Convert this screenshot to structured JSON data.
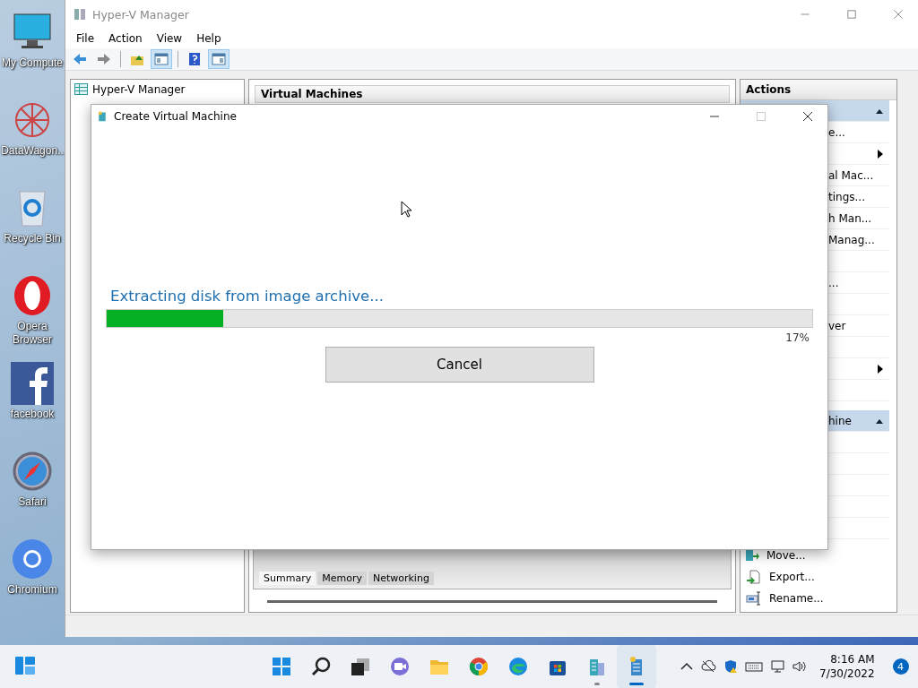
{
  "desktop_icons": [
    {
      "label": "My Compute"
    },
    {
      "label": "DataWagon.."
    },
    {
      "label": "Recycle Bin"
    },
    {
      "label": "Opera Browser"
    },
    {
      "label": "facebook"
    },
    {
      "label": "Safari"
    },
    {
      "label": "Chromium"
    }
  ],
  "window": {
    "title": "Hyper-V Manager",
    "menu": [
      "File",
      "Action",
      "View",
      "Help"
    ],
    "toolbar": [
      {
        "kind": "back",
        "pressed": false
      },
      {
        "kind": "forward",
        "pressed": false
      },
      {
        "kind": "up",
        "pressed": false
      },
      {
        "kind": "tree",
        "pressed": true
      },
      {
        "kind": "help",
        "pressed": false
      },
      {
        "kind": "actions",
        "pressed": true
      }
    ],
    "tree": [
      {
        "label": "Hyper-V Manager"
      }
    ],
    "center": {
      "title": "Virtual Machines",
      "tabs": [
        {
          "label": "Summary",
          "selected": true
        },
        {
          "label": "Memory",
          "selected": false
        },
        {
          "label": "Networking",
          "selected": false
        }
      ]
    },
    "actions": {
      "title": "Actions",
      "rows": [
        {
          "kind": "header"
        },
        {
          "kind": "partial",
          "text": "e..."
        },
        {
          "kind": "submenu"
        },
        {
          "kind": "partial",
          "text": "al Mac..."
        },
        {
          "kind": "partial",
          "text": "tings..."
        },
        {
          "kind": "partial",
          "text": "h Man..."
        },
        {
          "kind": "partial",
          "text": "Manag..."
        },
        {
          "kind": "covered"
        },
        {
          "kind": "partial",
          "text": "..."
        },
        {
          "kind": "covered"
        },
        {
          "kind": "partial",
          "text": "ver"
        },
        {
          "kind": "covered"
        },
        {
          "kind": "submenu"
        },
        {
          "kind": "covered"
        },
        {
          "kind": "header",
          "text": "hine"
        },
        {
          "kind": "covered"
        },
        {
          "kind": "covered"
        },
        {
          "kind": "covered"
        },
        {
          "kind": "covered"
        },
        {
          "kind": "covered"
        },
        {
          "kind": "item",
          "text": "Move..."
        },
        {
          "kind": "item",
          "text": "Export..."
        },
        {
          "kind": "item",
          "text": "Rename..."
        }
      ]
    }
  },
  "dialog": {
    "title": "Create Virtual Machine",
    "status": "Extracting disk from image archive...",
    "progress": {
      "level": 0.165,
      "reading": "17%"
    },
    "button": "Cancel"
  },
  "taskbar": {
    "apps": [
      {
        "kind": "start",
        "running": false,
        "active": false
      },
      {
        "kind": "search",
        "running": false,
        "active": false
      },
      {
        "kind": "taskview",
        "running": false,
        "active": false
      },
      {
        "kind": "chat",
        "running": false,
        "active": false
      },
      {
        "kind": "explorer",
        "running": false,
        "active": false
      },
      {
        "kind": "chrome",
        "running": false,
        "active": false
      },
      {
        "kind": "edge",
        "running": false,
        "active": false
      },
      {
        "kind": "store",
        "running": false,
        "active": false
      },
      {
        "kind": "hyperv",
        "running": true,
        "active": false
      },
      {
        "kind": "hyperv2",
        "running": true,
        "active": true
      }
    ],
    "time": "8:16 AM",
    "date": "7/30/2022",
    "badge": "4"
  }
}
